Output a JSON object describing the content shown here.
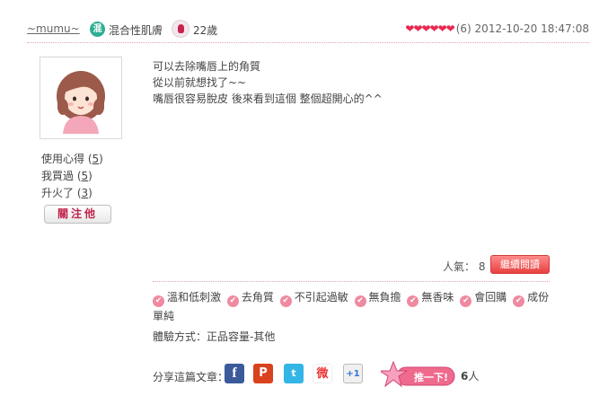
{
  "header": {
    "username": "~mumu~",
    "skin_badge": "混",
    "skin_type": "混合性肌膚",
    "age": "22歲",
    "hearts": "❤❤❤❤❤❤",
    "rating_count": "(6)",
    "timestamp": "2012-10-20 18:47:08"
  },
  "profile": {
    "stats": [
      {
        "label": "使用心得",
        "count": "5"
      },
      {
        "label": "我買過",
        "count": "5"
      },
      {
        "label": "升火了",
        "count": "3"
      }
    ],
    "follow_label": "關注他"
  },
  "review": {
    "lines": [
      "可以去除嘴唇上的角質",
      "從以前就想找了~~",
      "嘴唇很容易脫皮 後來看到這個 整個超開心的^^"
    ]
  },
  "popularity": {
    "label": "人氣：",
    "value": "8",
    "read_more": "繼續閱讀"
  },
  "tags": [
    "溫和低刺激",
    "去角質",
    "不引起過敏",
    "無負擔",
    "無香味",
    "會回購",
    "成份單純"
  ],
  "experience": {
    "label": "體驗方式：",
    "value": "正品容量-其他"
  },
  "share": {
    "label": "分享這篇文章：",
    "icons": [
      "facebook-icon",
      "plurk-icon",
      "twitter-icon",
      "weibo-icon",
      "google-plus-icon"
    ],
    "facebook_glyph": "f",
    "plurk_glyph": "P",
    "twitter_glyph": "t",
    "weibo_glyph": "微",
    "gplus_glyph": "+1",
    "push_label": "推一下!",
    "push_count": "6",
    "push_unit": "人"
  },
  "colors": {
    "accent_pink": "#e8284f",
    "skin_badge": "#2fae93",
    "read_more": "#e8403f"
  }
}
